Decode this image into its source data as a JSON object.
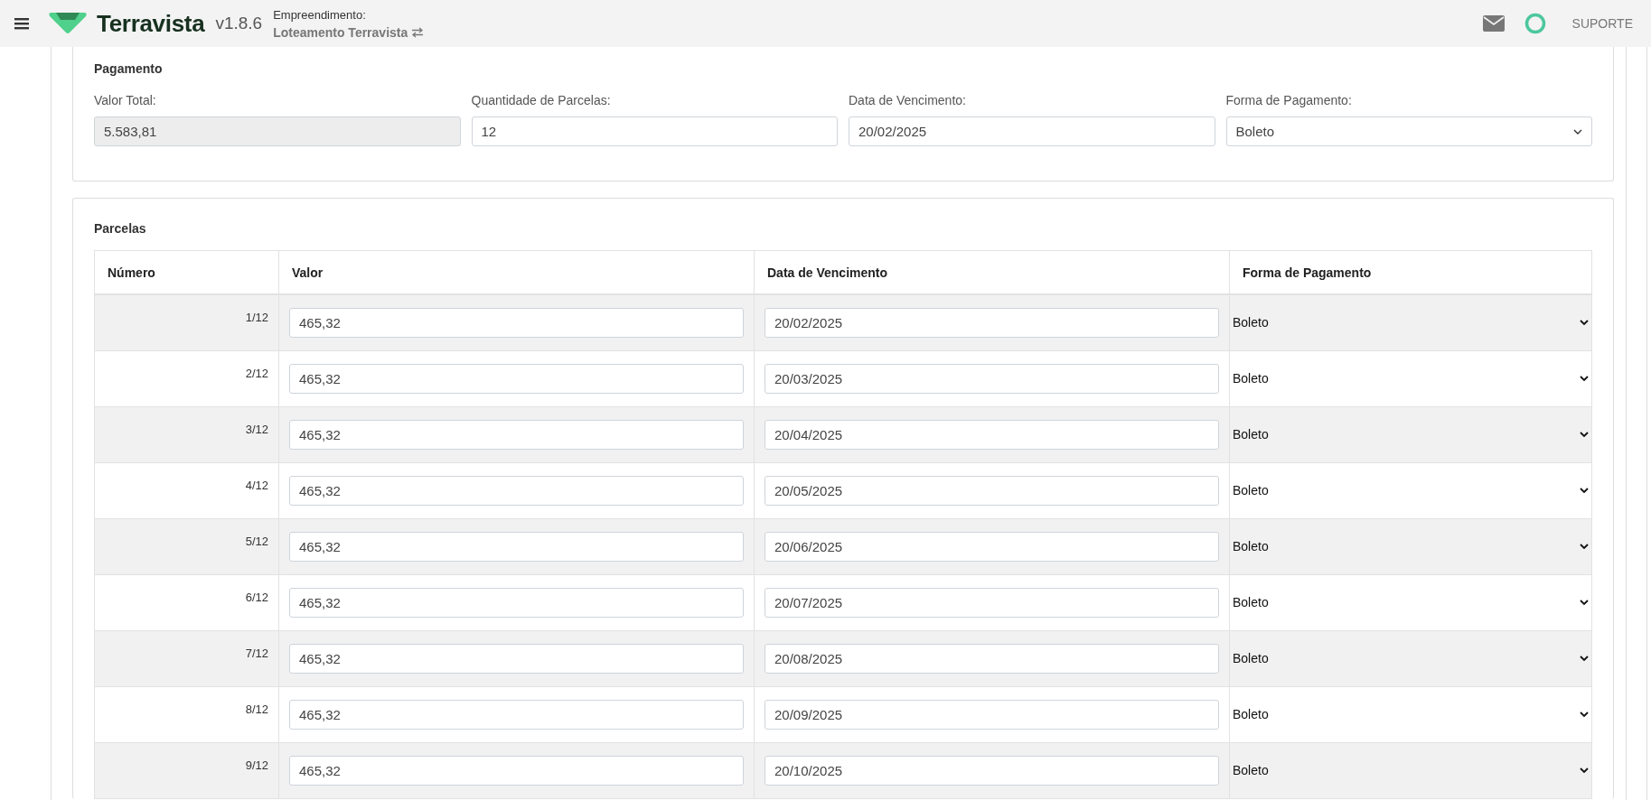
{
  "header": {
    "app_name": "Terravista",
    "version": "v1.8.6",
    "project_label": "Empreendimento:",
    "project_name": "Loteamento Terravista",
    "support": "SUPORTE"
  },
  "pagamento": {
    "title": "Pagamento",
    "fields": [
      {
        "label": "Valor Total:",
        "value": "5.583,81",
        "kind": "input",
        "disabled": true
      },
      {
        "label": "Quantidade de Parcelas:",
        "value": "12",
        "kind": "input",
        "disabled": false
      },
      {
        "label": "Data de Vencimento:",
        "value": "20/02/2025",
        "kind": "input",
        "disabled": false
      },
      {
        "label": "Forma de Pagamento:",
        "value": "Boleto",
        "kind": "select",
        "disabled": false
      }
    ]
  },
  "parcelas": {
    "title": "Parcelas",
    "columns": [
      "Número",
      "Valor",
      "Data de Vencimento",
      "Forma de Pagamento"
    ],
    "rows": [
      {
        "numero": "1/12",
        "valor": "465,32",
        "vencimento": "20/02/2025",
        "forma": "Boleto"
      },
      {
        "numero": "2/12",
        "valor": "465,32",
        "vencimento": "20/03/2025",
        "forma": "Boleto"
      },
      {
        "numero": "3/12",
        "valor": "465,32",
        "vencimento": "20/04/2025",
        "forma": "Boleto"
      },
      {
        "numero": "4/12",
        "valor": "465,32",
        "vencimento": "20/05/2025",
        "forma": "Boleto"
      },
      {
        "numero": "5/12",
        "valor": "465,32",
        "vencimento": "20/06/2025",
        "forma": "Boleto"
      },
      {
        "numero": "6/12",
        "valor": "465,32",
        "vencimento": "20/07/2025",
        "forma": "Boleto"
      },
      {
        "numero": "7/12",
        "valor": "465,32",
        "vencimento": "20/08/2025",
        "forma": "Boleto"
      },
      {
        "numero": "8/12",
        "valor": "465,32",
        "vencimento": "20/09/2025",
        "forma": "Boleto"
      },
      {
        "numero": "9/12",
        "valor": "465,32",
        "vencimento": "20/10/2025",
        "forma": "Boleto"
      }
    ]
  }
}
